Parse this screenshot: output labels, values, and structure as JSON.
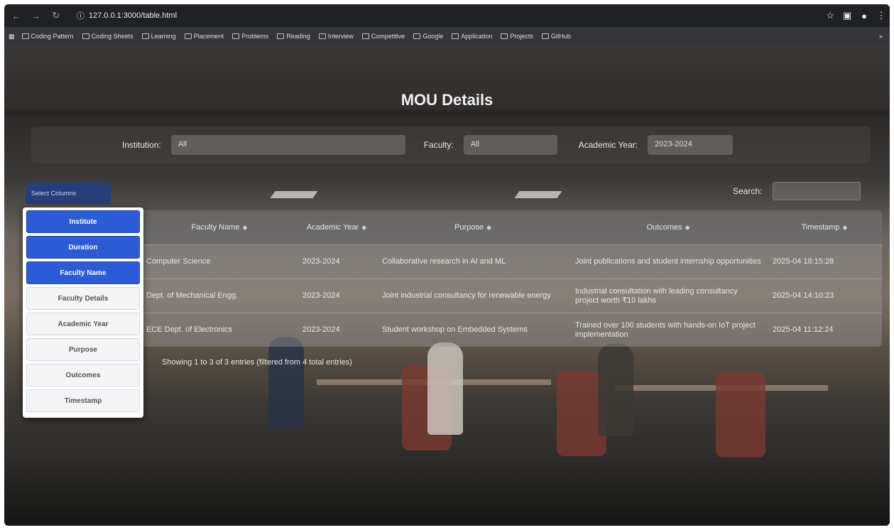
{
  "browser": {
    "url": "127.0.0.1:3000/table.html",
    "bookmarks": [
      "Coding Pattern",
      "Coding Sheets",
      "Learning",
      "Placement",
      "Problems",
      "Reading",
      "Interview",
      "Competitive",
      "Google",
      "Application",
      "Projects",
      "GitHub"
    ]
  },
  "page": {
    "title": "MOU Details",
    "filters": {
      "institution_label": "Institution:",
      "institution_value": "All",
      "faculty_label": "Faculty:",
      "faculty_value": "All",
      "year_label": "Academic Year:",
      "year_value": "2023-2024"
    },
    "column_button": "Select Columns",
    "search_label": "Search:",
    "search_value": "",
    "columns": [
      "Faculty Name",
      "Academic Year",
      "Purpose",
      "Outcomes",
      "Timestamp"
    ],
    "rows": [
      [
        "Computer Science",
        "2023-2024",
        "Collaborative research in AI and ML",
        "Joint publications and student internship opportunities",
        "2025-04 18:15:28"
      ],
      [
        "Dept. of Mechanical Engg.",
        "2023-2024",
        "Joint industrial consultancy for renewable energy",
        "Industrial consultation with leading consultancy project worth ₹10 lakhs",
        "2025-04 14:10:23"
      ],
      [
        "ECE Dept. of Electronics",
        "2023-2024",
        "Student workshop on Embedded Systems",
        "Trained over 100 students with hands-on IoT project implementation",
        "2025-04 11:12:24"
      ]
    ],
    "info": "Showing 1 to 3 of 3 entries (filtered from 4 total entries)",
    "column_menu": [
      {
        "label": "Institute",
        "active": true
      },
      {
        "label": "Duration",
        "active": true
      },
      {
        "label": "Faculty Name",
        "active": true
      },
      {
        "label": "Faculty Details",
        "active": false
      },
      {
        "label": "Academic Year",
        "active": false
      },
      {
        "label": "Purpose",
        "active": false
      },
      {
        "label": "Outcomes",
        "active": false
      },
      {
        "label": "Timestamp",
        "active": false
      }
    ]
  }
}
